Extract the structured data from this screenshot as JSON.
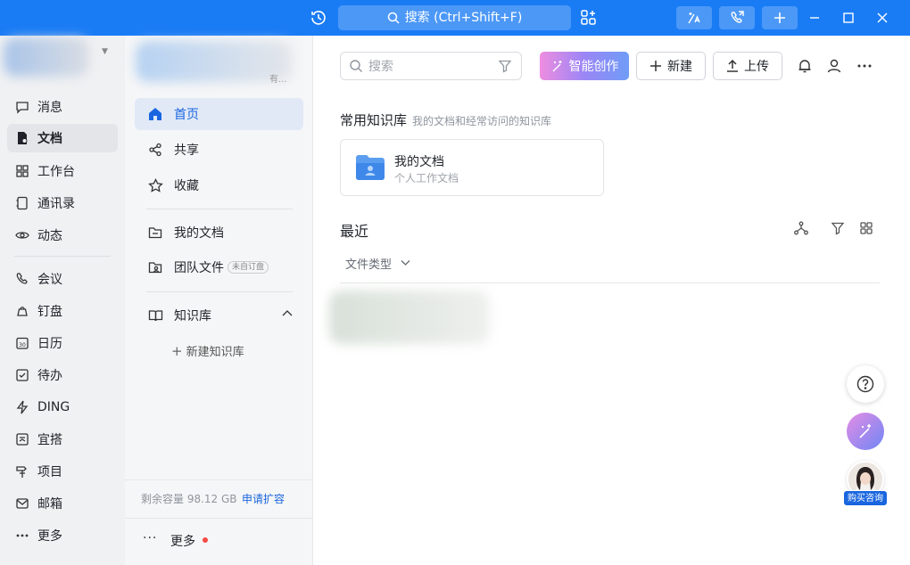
{
  "titlebar": {
    "search_label": "搜索 (Ctrl+Shift+F)"
  },
  "rail": {
    "items": [
      {
        "label": "消息"
      },
      {
        "label": "文档"
      },
      {
        "label": "工作台"
      },
      {
        "label": "通讯录"
      },
      {
        "label": "动态"
      },
      {
        "label": "会议"
      },
      {
        "label": "钉盘"
      },
      {
        "label": "日历"
      },
      {
        "label": "待办"
      },
      {
        "label": "DING"
      },
      {
        "label": "宜搭"
      },
      {
        "label": "项目"
      },
      {
        "label": "邮箱"
      },
      {
        "label": "更多"
      }
    ],
    "calendar_day": "30"
  },
  "sidebar": {
    "workspace_tail": "有...",
    "nav": [
      {
        "label": "首页"
      },
      {
        "label": "共享"
      },
      {
        "label": "收藏"
      }
    ],
    "my_docs": "我的文档",
    "team_files": "团队文件",
    "team_tag": "未自订盘",
    "knowledge_base": "知识库",
    "new_kb": "新建知识库",
    "storage": "剩余容量 98.12 GB",
    "expand": "申请扩容",
    "more": "更多"
  },
  "main": {
    "search_placeholder": "搜索",
    "ai_create": "智能创作",
    "new": "新建",
    "upload": "上传",
    "common_kb_title": "常用知识库",
    "common_kb_sub": "我的文档和经常访问的知识库",
    "card_name": "我的文档",
    "card_desc": "个人工作文档",
    "recent_title": "最近",
    "file_type": "文件类型"
  },
  "floating": {
    "badge": "购买咨询"
  },
  "colors": {
    "titlebar": "#1a7cf5",
    "accent": "#1a66e0",
    "active_nav_bg": "#e1e9f7"
  }
}
